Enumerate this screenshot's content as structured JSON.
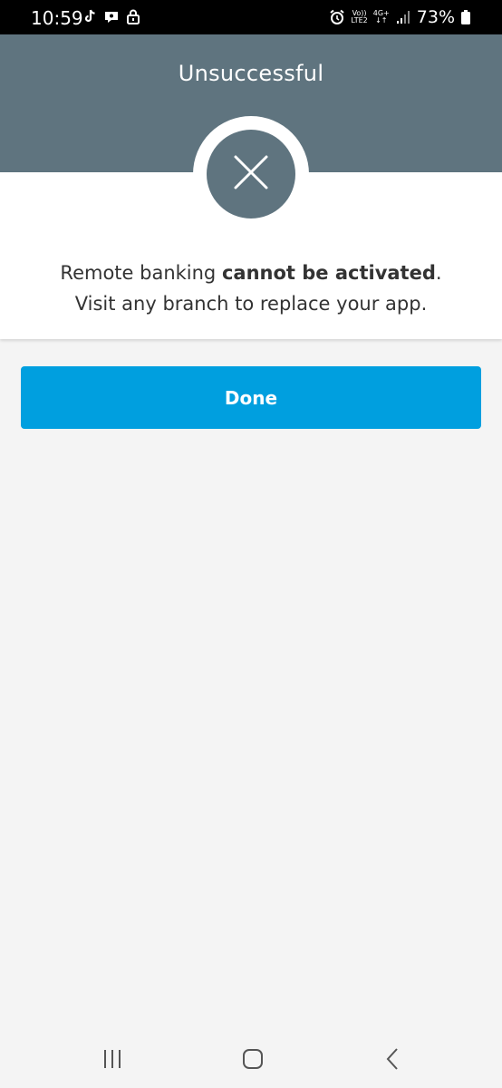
{
  "status_bar": {
    "time": "10:59",
    "network_top": "Vo))",
    "network_bottom": "LTE2",
    "signal_type": "4G+",
    "battery_percent": "73%",
    "icons_left": [
      "tiktok-icon",
      "chat-icon",
      "lock-icon"
    ],
    "icons_right": [
      "alarm-icon",
      "signal-icon",
      "battery-icon"
    ]
  },
  "header": {
    "title": "Unsuccessful",
    "color": "#5f747f"
  },
  "result": {
    "icon": "close-icon",
    "message_prefix": "Remote banking ",
    "message_bold": "cannot be activated",
    "message_suffix": ".",
    "message_line2": "Visit any branch to replace your app."
  },
  "actions": {
    "done_label": "Done",
    "done_color": "#009fdf"
  },
  "nav": {
    "items": [
      "recent-apps-icon",
      "home-icon",
      "back-icon"
    ]
  }
}
